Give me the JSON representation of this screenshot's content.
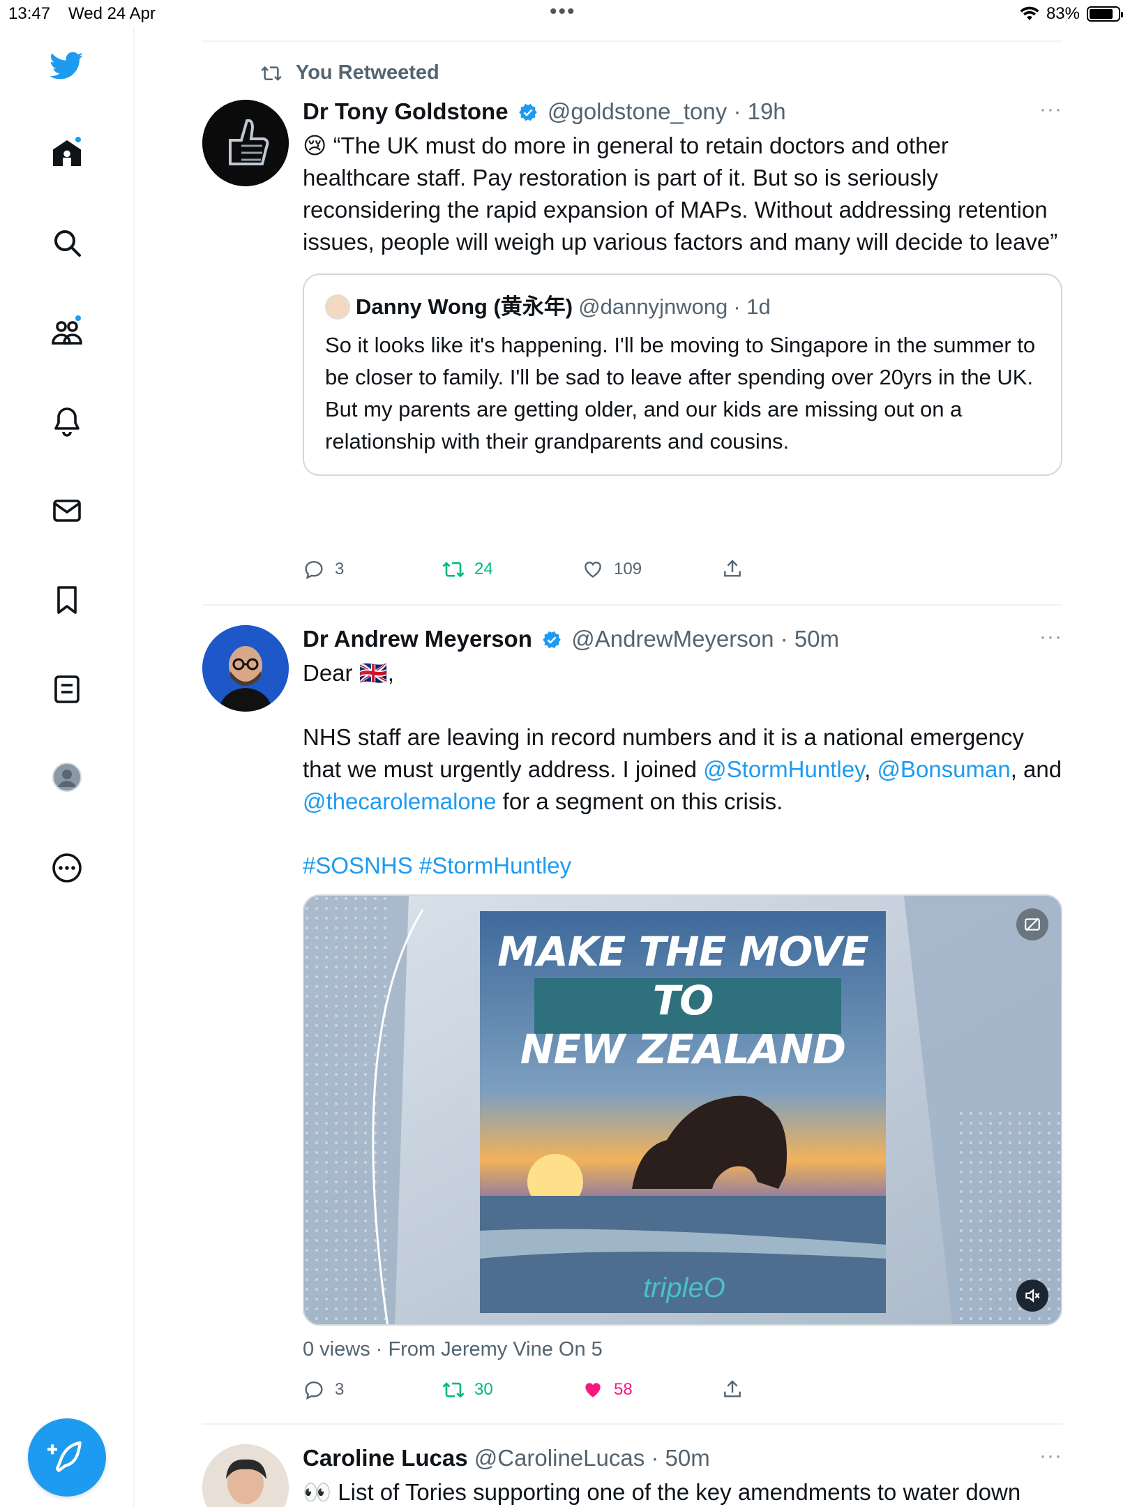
{
  "status_bar": {
    "time": "13:47",
    "date": "Wed 24 Apr",
    "battery_percent": "83%",
    "battery_level": 0.83
  },
  "sidebar": {
    "items": [
      {
        "icon": "twitter-bird-icon"
      },
      {
        "icon": "home-icon",
        "notification": true
      },
      {
        "icon": "search-icon"
      },
      {
        "icon": "communities-icon",
        "notification": true
      },
      {
        "icon": "notifications-bell-icon"
      },
      {
        "icon": "messages-mail-icon"
      },
      {
        "icon": "bookmark-icon"
      },
      {
        "icon": "lists-icon"
      },
      {
        "icon": "profile-avatar-icon"
      },
      {
        "icon": "more-circle-icon"
      }
    ],
    "compose_icon": "compose-feather-icon"
  },
  "colors": {
    "accent": "#1d9bf0",
    "retweet_green": "#00ba7c",
    "like_pink": "#f91880",
    "secondary_text": "#536471"
  },
  "tweets": [
    {
      "retweet_label": "You Retweeted",
      "name": "Dr Tony Goldstone",
      "handle": "@goldstone_tony",
      "time": "· 19h",
      "text": "😢 “The UK must do more in general to retain doctors and other healthcare staff. Pay restoration is part of it. But so is seriously reconsidering the rapid expansion of MAPs. Without addressing retention issues, people will weigh up various factors and many will decide to leave”",
      "quote": {
        "name": "Danny Wong (黄永年)",
        "handle": "@dannyjnwong",
        "time": "· 1d",
        "text": "So it looks like it's happening. I'll be moving to Singapore in the summer to be closer to family. I'll be sad to leave after spending over 20yrs in the UK. But my parents are getting older, and our kids are missing out on a relationship with their grandparents and cousins."
      },
      "replies": "3",
      "retweets": "24",
      "likes": "109"
    },
    {
      "name": "Dr Andrew Meyerson",
      "handle": "@AndrewMeyerson",
      "time": "· 50m",
      "text_dear": "Dear 🇬🇧,",
      "text_p1": "NHS staff are leaving in record numbers and it is a national emergency that we must urgently address. I joined ",
      "mention1": "@StormHuntley",
      "sep1": ", ",
      "mention2": "@Bonsuman",
      "sep2": ", and ",
      "mention3": "@thecarolemalone",
      "text_p1_end": " for a segment on this crisis.",
      "hashtags": "#SOSNHS #StormHuntley",
      "media": {
        "headline_line1": "MAKE THE MOVE TO",
        "headline_line2": "NEW ZEALAND",
        "brand": "tripleO"
      },
      "views": "0 views · From Jeremy Vine On 5",
      "replies": "3",
      "retweets": "30",
      "likes": "58"
    },
    {
      "name": "Caroline Lucas",
      "handle": "@CarolineLucas",
      "time": "· 50m",
      "text": "👀 List of Tories supporting one of the key amendments to water down"
    }
  ],
  "more_label": "···"
}
